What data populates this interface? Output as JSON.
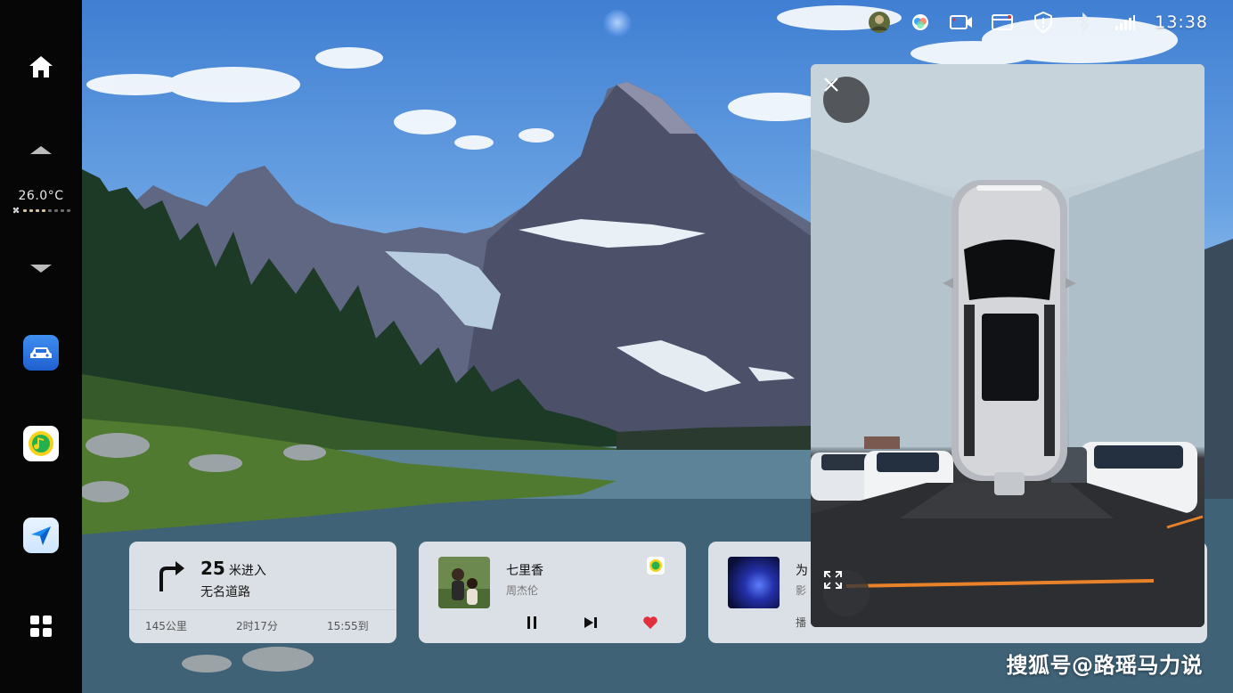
{
  "status_bar": {
    "time": "13:38",
    "icons": [
      "avatar-icon",
      "assistant-icon",
      "camera-icon",
      "message-icon",
      "shield-icon",
      "bluetooth-icon",
      "signal-icon"
    ]
  },
  "dock": {
    "temperature": "26.0°C",
    "fan_level": 4,
    "fan_level_max": 8,
    "items": [
      "home-icon",
      "chevron-up-icon",
      "chevron-down-icon",
      "car-app-icon",
      "qq-music-icon",
      "navigation-app-icon",
      "grid-icon"
    ]
  },
  "navigation": {
    "distance": "25",
    "unit": "米进入",
    "road": "无名道路",
    "remaining_distance": "145公里",
    "remaining_time": "2时17分",
    "eta": "15:55到"
  },
  "music": {
    "title": "七里香",
    "artist": "周杰伦"
  },
  "third_card": {
    "title": "为",
    "subtitle": "影",
    "footer": "播"
  },
  "watermark": "搜狐号@路瑶马力说",
  "colors": {
    "dock_bg": "#060606",
    "card_bg": "#eceef2",
    "heart": "#e0303c",
    "guide_line": "#e8822a"
  }
}
